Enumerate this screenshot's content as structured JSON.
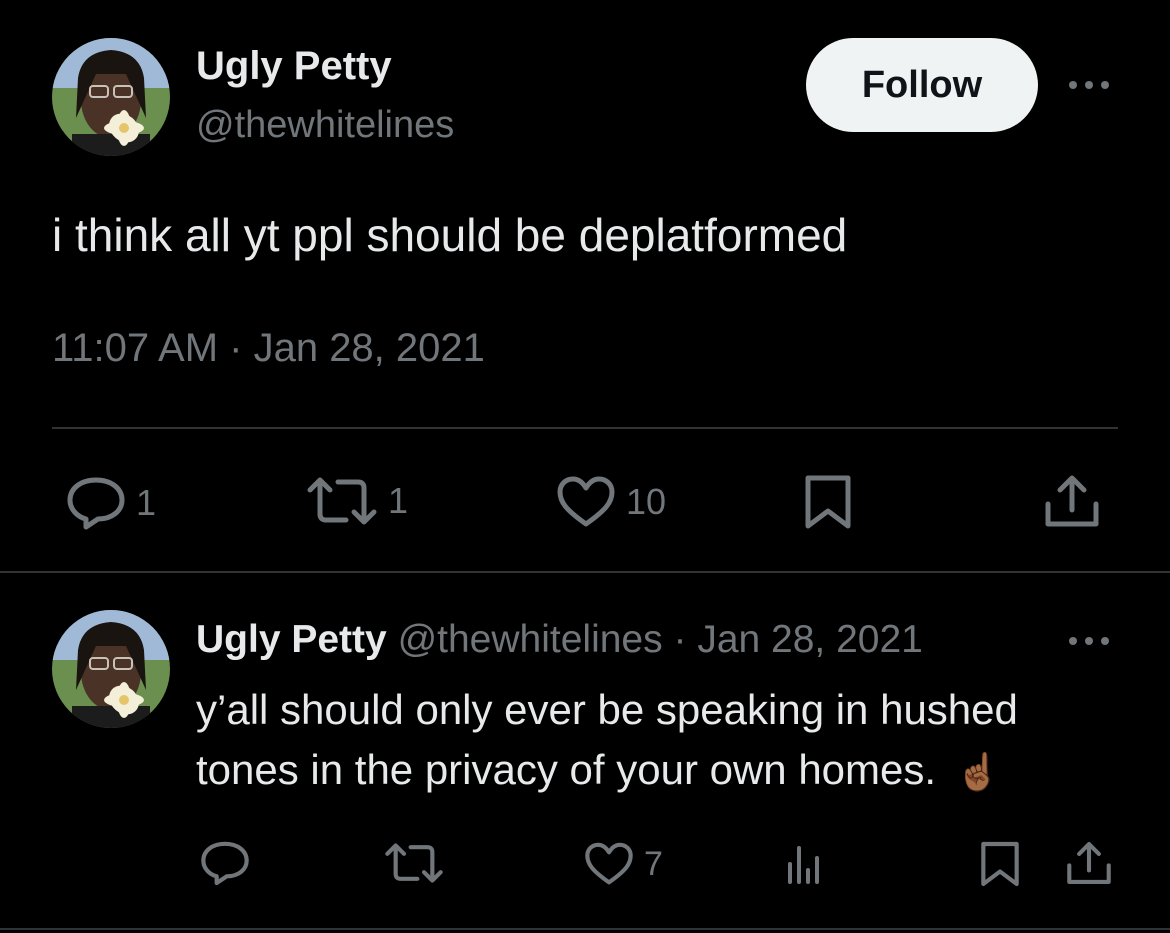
{
  "main_tweet": {
    "author_name": "Ugly Petty",
    "author_handle": "@thewhitelines",
    "follow_label": "Follow",
    "text": "i think all yt ppl should be deplatformed",
    "timestamp": "11:07 AM · Jan 28, 2021",
    "replies": "1",
    "retweets": "1",
    "likes": "10"
  },
  "reply_tweet": {
    "author_name": "Ugly Petty",
    "author_handle": "@thewhitelines",
    "separator": "·",
    "date": "Jan 28, 2021",
    "text": "y’all should only ever be speaking in hushed tones in the privacy of your own homes.",
    "emoji": "☝🏾",
    "likes": "7"
  },
  "colors": {
    "background": "#000000",
    "text": "#e7e9ea",
    "muted": "#71767b",
    "divider": "#2f3336",
    "follow_bg": "#eff3f4"
  },
  "icons": [
    "reply-icon",
    "retweet-icon",
    "like-icon",
    "bookmark-icon",
    "share-icon",
    "views-icon",
    "more-icon"
  ]
}
